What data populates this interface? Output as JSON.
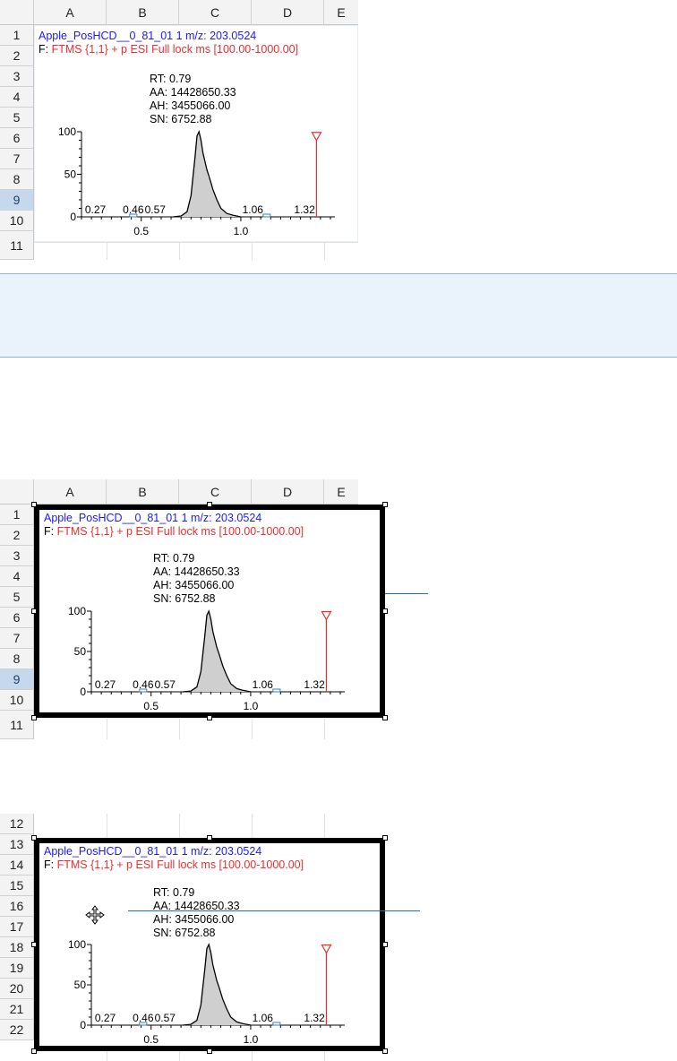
{
  "columns": [
    "A",
    "B",
    "C",
    "D",
    "E"
  ],
  "panel1": {
    "rows": [
      "1",
      "2",
      "3",
      "4",
      "5",
      "6",
      "7",
      "8",
      "9",
      "10",
      "11"
    ],
    "selected_row": "9"
  },
  "panel2": {
    "rows": [
      "1",
      "2",
      "3",
      "4",
      "5",
      "6",
      "7",
      "8",
      "9",
      "10",
      "11"
    ],
    "selected_row": "9"
  },
  "panel3": {
    "rows": [
      "12",
      "13",
      "14",
      "15",
      "16",
      "17",
      "18",
      "19",
      "20",
      "21",
      "22"
    ]
  },
  "chart": {
    "title_line1": "Apple_PosHCD__0_81_01   1      m/z: 203.0524",
    "filter_prefix": "F: ",
    "filter_text": "FTMS {1,1}  + p ESI Full lock ms [100.00-1000.00]",
    "rt": "RT: 0.79",
    "aa": "AA: 14428650.33",
    "ah": "AH: 3455066.00",
    "sn": "SN: 6752.88",
    "sn_overlap": "SN: 6752.88"
  },
  "chart_data": {
    "type": "area",
    "xlim": [
      0.2,
      1.45
    ],
    "ylim": [
      0,
      100
    ],
    "yticks": [
      "100",
      "50",
      "0"
    ],
    "xtick_labels": [
      "0.5",
      "1.0"
    ],
    "peak_labels": [
      {
        "x": 0.27,
        "label": "0.27"
      },
      {
        "x": 0.46,
        "label": "0.46"
      },
      {
        "x": 0.57,
        "label": "0.57"
      },
      {
        "x": 1.06,
        "label": "1.06"
      },
      {
        "x": 1.32,
        "label": "1.32"
      }
    ],
    "x": [
      0.66,
      0.7,
      0.73,
      0.75,
      0.77,
      0.78,
      0.79,
      0.8,
      0.81,
      0.82,
      0.83,
      0.84,
      0.86,
      0.88,
      0.9,
      0.93,
      0.96,
      1.0
    ],
    "y": [
      0,
      1,
      6,
      25,
      70,
      95,
      100,
      90,
      75,
      65,
      55,
      48,
      32,
      20,
      10,
      4,
      2,
      0
    ],
    "marker": {
      "x": 1.38,
      "y": 95,
      "color": "#e53030"
    },
    "fill_color": "#cfcfcf",
    "line_color": "#000000"
  }
}
